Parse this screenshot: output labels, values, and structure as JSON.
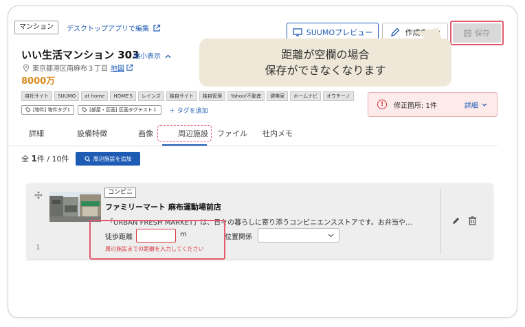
{
  "header": {
    "property_type": "マンション",
    "desktop_edit_link": "デスクトップアプリで編集",
    "preview_button": "SUUMOプレビュー",
    "status_button": "作成中",
    "save_button": "保存"
  },
  "property": {
    "name": "いい生活マンション 303",
    "shrink_link": "縮小表示",
    "address": "東京都港区南麻布３丁目",
    "map_link": "地図",
    "price": "8000万"
  },
  "site_tags": [
    "自社サイト",
    "SUUMO",
    "at home",
    "HOME'S",
    "レインズ",
    "独自サイト",
    "独自管理",
    "Yahoo!不動産",
    "健美家",
    "ホームナビ",
    "オウチーノ"
  ],
  "label_tags": [
    "[物件] 物件タグ1",
    "[部屋・区画] 区画タグテスト１"
  ],
  "add_tag_link": "＋ タグを追加",
  "tooltip": {
    "line1": "距離が空欄の場合",
    "line2": "保存ができなくなります"
  },
  "error_banner": {
    "icon": "!",
    "text": "修正箇所: 1件",
    "detail_link": "詳細"
  },
  "tabs": [
    {
      "label": "詳細"
    },
    {
      "label": "設備特徴"
    },
    {
      "label": "画像"
    },
    {
      "label": "周辺施設"
    },
    {
      "label": "ファイル"
    },
    {
      "label": "社内メモ"
    }
  ],
  "active_tab": "周辺施設",
  "facilities_summary": {
    "prefix": "全",
    "count": "1",
    "suffix": "件 / 10件",
    "add_button": "周辺施設を追加"
  },
  "facility": {
    "index": "1",
    "category": "コンビニ",
    "name": "ファミリーマート 麻布運動場前店",
    "description": "「URBAN FRESH MARKET」は、日々の暮らしに寄り添うコンビニエンスストアです。お弁当や…",
    "walk_label": "徒歩距離",
    "walk_value": "",
    "unit": "m",
    "relation_label": "位置関係",
    "relation_value": "",
    "walk_error": "周辺施設までの距離を入力してください"
  },
  "colors": {
    "accent": "#1d5bb5",
    "price": "#d8891b",
    "error": "#d9363e",
    "highlight": "#e35a6e",
    "tooltip_bg": "#efe8d8"
  }
}
